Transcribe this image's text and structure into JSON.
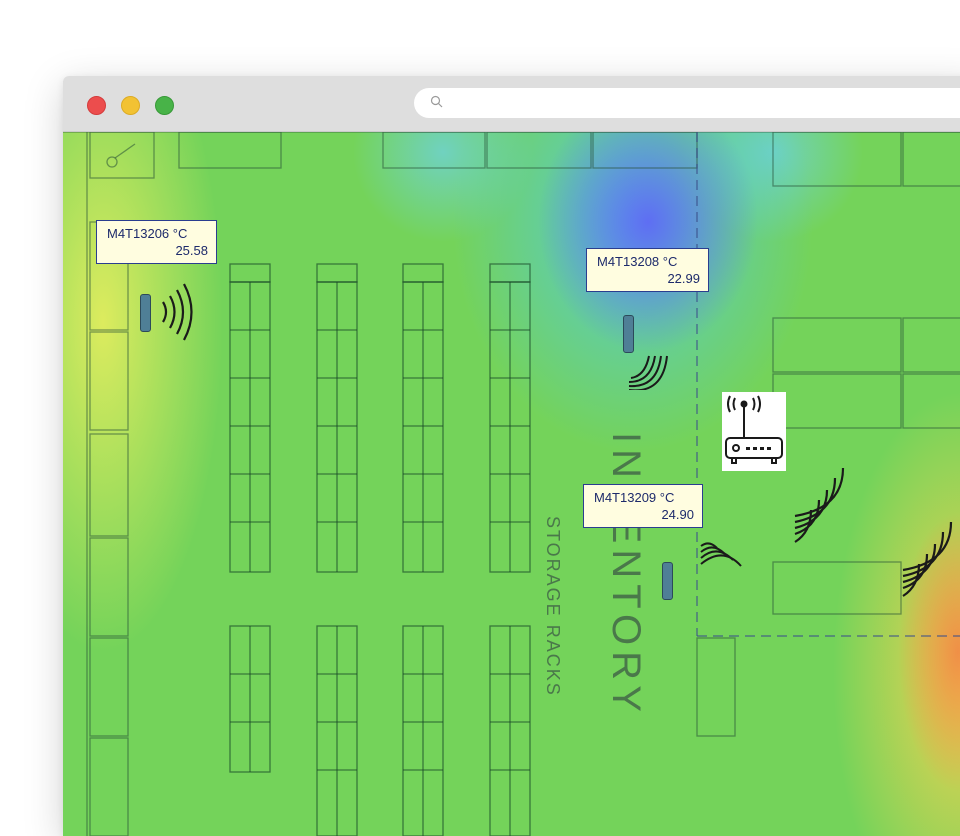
{
  "browser": {
    "traffic_lights": [
      "close",
      "minimize",
      "maximize"
    ],
    "address": {
      "value": "",
      "icon": "search-icon"
    }
  },
  "floor": {
    "area_label": "INVENTORY",
    "zone_label": "STORAGE RACKS"
  },
  "sensors": [
    {
      "name": "M4T13206 °C",
      "value": "25.58"
    },
    {
      "name": "M4T13208 °C",
      "value": "22.99"
    },
    {
      "name": "M4T13209 °C",
      "value": "24.90"
    }
  ],
  "gateway": {
    "icon": "router-icon"
  },
  "colors": {
    "heat_cool": "#5b63f2",
    "heat_mid": "#74d35a",
    "heat_warm": "#f3e45a",
    "heat_hot": "#f08c46",
    "label_bg": "#fffde0",
    "label_border": "#2a3d8f"
  }
}
